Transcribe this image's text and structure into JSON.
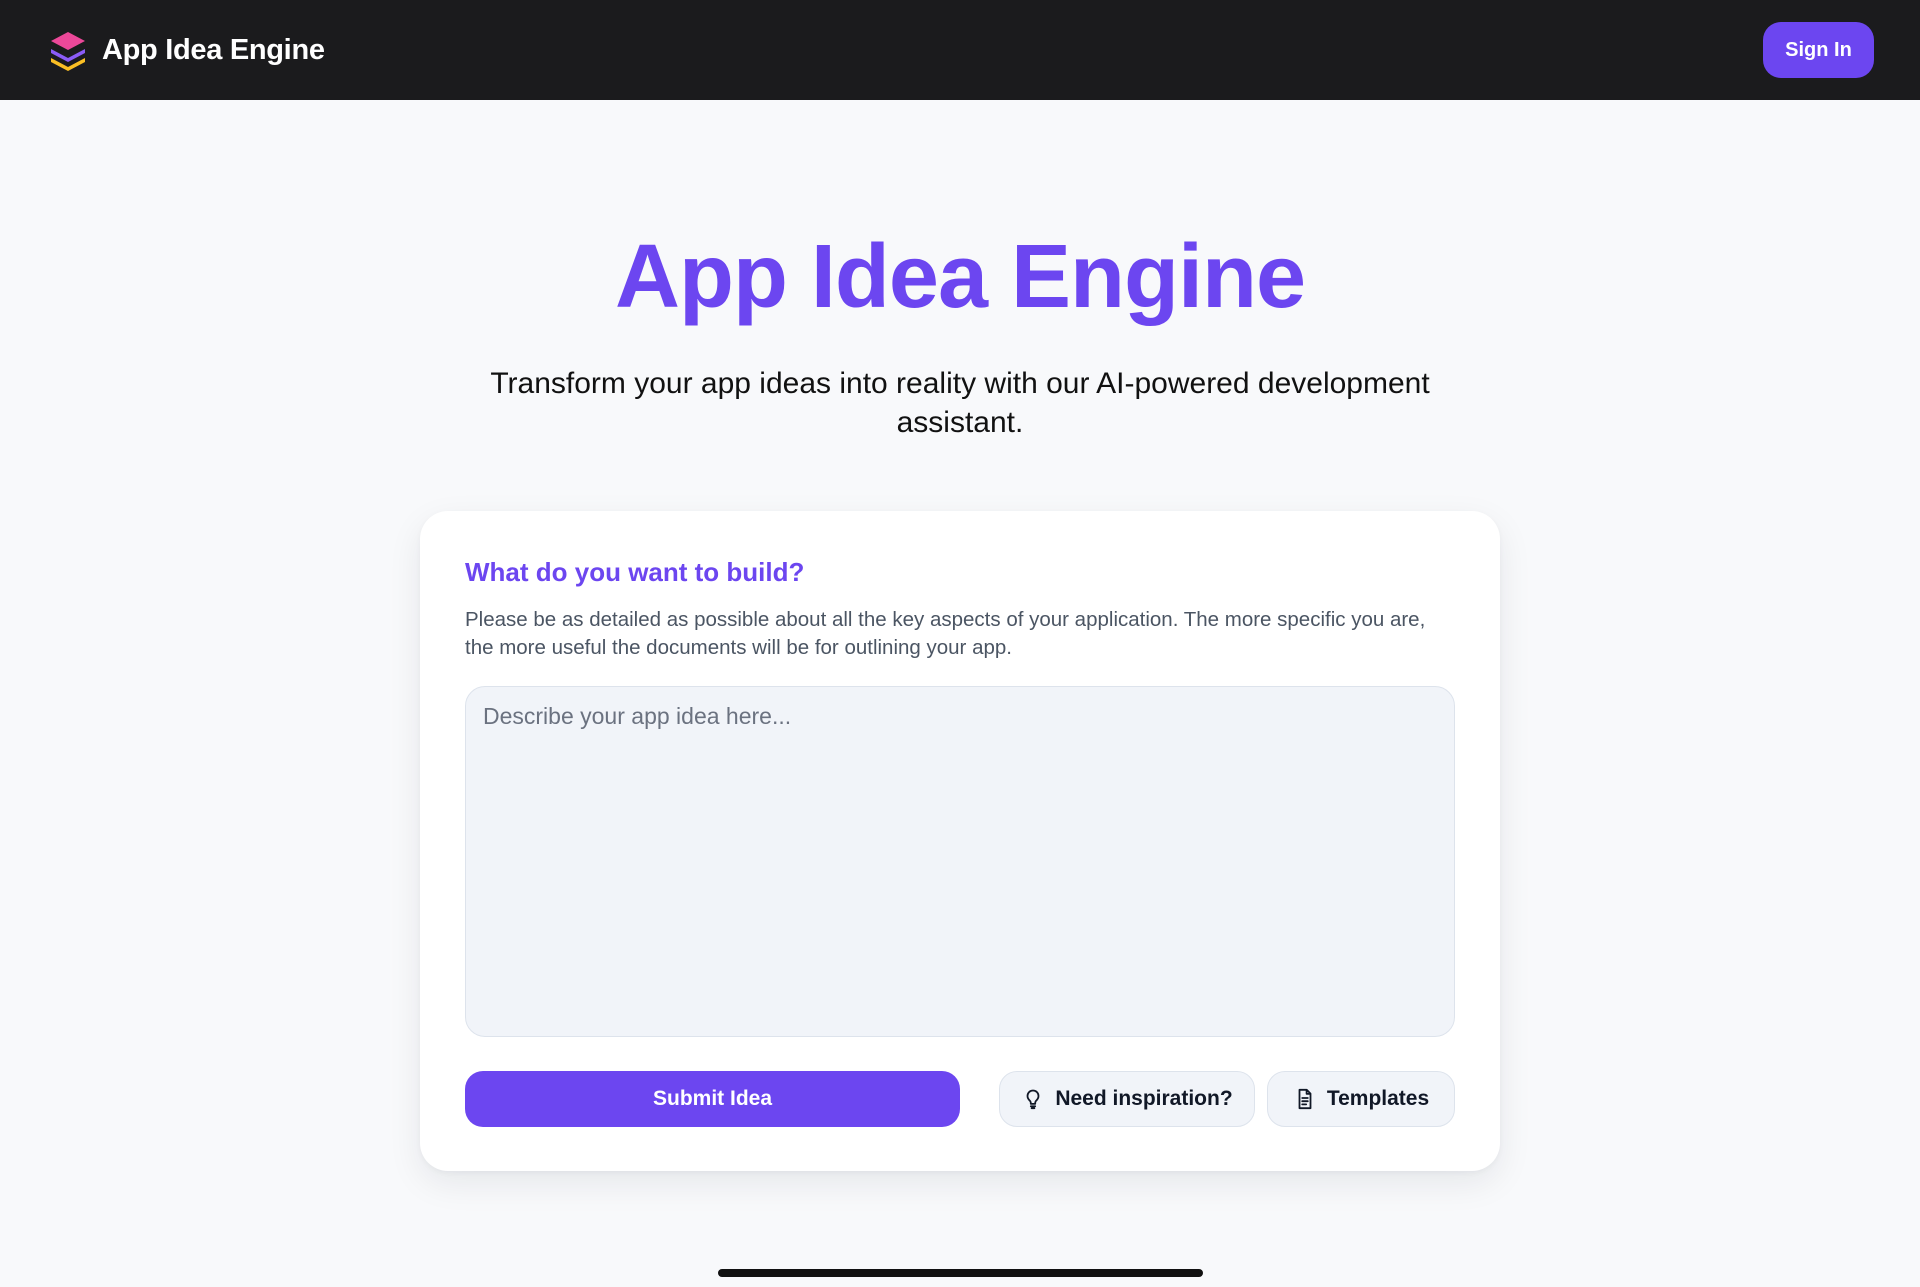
{
  "header": {
    "app_name": "App Idea Engine",
    "signin_label": "Sign In"
  },
  "hero": {
    "title": "App Idea Engine",
    "subtitle": "Transform your app ideas into reality with our AI-powered development assistant."
  },
  "form": {
    "heading": "What do you want to build?",
    "description": "Please be as detailed as possible about all the key aspects of your application. The more specific you are, the more useful the documents will be for outlining your app.",
    "input_value": "",
    "input_placeholder": "Describe your app idea here...",
    "submit_label": "Submit Idea",
    "inspiration_label": "Need inspiration?",
    "templates_label": "Templates"
  },
  "icons": {
    "logo": "layers-icon",
    "inspiration": "lightbulb-icon",
    "templates": "document-icon"
  },
  "colors": {
    "accent": "#6c46f0",
    "header_bg": "#1b1b1d",
    "page_bg": "#f8f9fb",
    "input_bg": "#f1f4f9",
    "logo_pink": "#ec4899",
    "logo_purple": "#8b5cf6",
    "logo_yellow": "#fbbf24"
  }
}
